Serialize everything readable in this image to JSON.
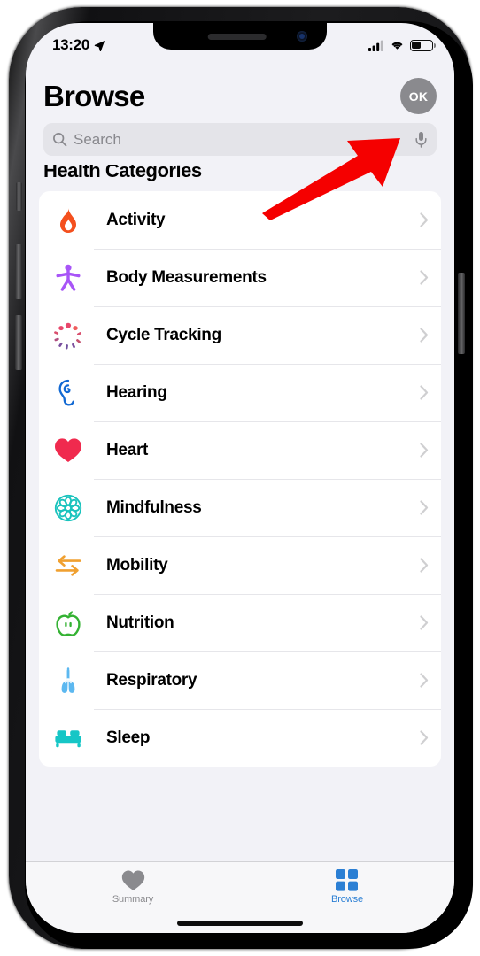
{
  "status_bar": {
    "time": "13:20",
    "location_icon": "location-arrow-icon",
    "signal_icon": "cellular-signal-icon",
    "wifi_icon": "wifi-icon",
    "battery_icon": "battery-icon",
    "battery_level_percent": 40
  },
  "header": {
    "title": "Browse",
    "avatar_initials": "OK"
  },
  "search": {
    "placeholder": "Search",
    "search_icon": "search-icon",
    "mic_icon": "microphone-icon"
  },
  "main": {
    "section_title": "Health Categories",
    "categories": [
      {
        "label": "Activity",
        "icon": "flame-icon",
        "color": "#f4501e"
      },
      {
        "label": "Body Measurements",
        "icon": "body-figure-icon",
        "color": "#a855f7"
      },
      {
        "label": "Cycle Tracking",
        "icon": "cycle-dots-icon",
        "color": "#e8476b"
      },
      {
        "label": "Hearing",
        "icon": "ear-icon",
        "color": "#1269d3"
      },
      {
        "label": "Heart",
        "icon": "heart-icon",
        "color": "#f02a4e"
      },
      {
        "label": "Mindfulness",
        "icon": "mandala-icon",
        "color": "#19c3bd"
      },
      {
        "label": "Mobility",
        "icon": "arrows-icon",
        "color": "#f0a030"
      },
      {
        "label": "Nutrition",
        "icon": "apple-icon",
        "color": "#34b233"
      },
      {
        "label": "Respiratory",
        "icon": "lungs-icon",
        "color": "#5cb8f0"
      },
      {
        "label": "Sleep",
        "icon": "bed-icon",
        "color": "#16c6c6"
      }
    ],
    "chevron_icon": "chevron-right-icon"
  },
  "tab_bar": {
    "tabs": [
      {
        "label": "Summary",
        "icon": "heart-filled-icon",
        "active": false
      },
      {
        "label": "Browse",
        "icon": "grid-squares-icon",
        "active": true
      }
    ],
    "active_color": "#2b7fd4",
    "inactive_color": "#8a8a8e"
  },
  "annotation": {
    "arrow_color": "#f50000",
    "arrow_target": "avatar-profile-button"
  }
}
